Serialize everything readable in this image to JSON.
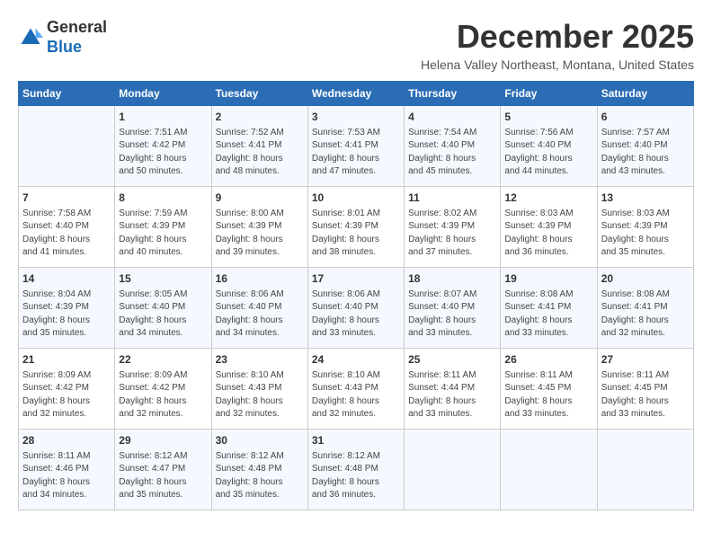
{
  "header": {
    "logo_line1": "General",
    "logo_line2": "Blue",
    "month": "December 2025",
    "location": "Helena Valley Northeast, Montana, United States"
  },
  "days_of_week": [
    "Sunday",
    "Monday",
    "Tuesday",
    "Wednesday",
    "Thursday",
    "Friday",
    "Saturday"
  ],
  "weeks": [
    [
      {
        "day": "",
        "info": ""
      },
      {
        "day": "1",
        "info": "Sunrise: 7:51 AM\nSunset: 4:42 PM\nDaylight: 8 hours\nand 50 minutes."
      },
      {
        "day": "2",
        "info": "Sunrise: 7:52 AM\nSunset: 4:41 PM\nDaylight: 8 hours\nand 48 minutes."
      },
      {
        "day": "3",
        "info": "Sunrise: 7:53 AM\nSunset: 4:41 PM\nDaylight: 8 hours\nand 47 minutes."
      },
      {
        "day": "4",
        "info": "Sunrise: 7:54 AM\nSunset: 4:40 PM\nDaylight: 8 hours\nand 45 minutes."
      },
      {
        "day": "5",
        "info": "Sunrise: 7:56 AM\nSunset: 4:40 PM\nDaylight: 8 hours\nand 44 minutes."
      },
      {
        "day": "6",
        "info": "Sunrise: 7:57 AM\nSunset: 4:40 PM\nDaylight: 8 hours\nand 43 minutes."
      }
    ],
    [
      {
        "day": "7",
        "info": "Sunrise: 7:58 AM\nSunset: 4:40 PM\nDaylight: 8 hours\nand 41 minutes."
      },
      {
        "day": "8",
        "info": "Sunrise: 7:59 AM\nSunset: 4:39 PM\nDaylight: 8 hours\nand 40 minutes."
      },
      {
        "day": "9",
        "info": "Sunrise: 8:00 AM\nSunset: 4:39 PM\nDaylight: 8 hours\nand 39 minutes."
      },
      {
        "day": "10",
        "info": "Sunrise: 8:01 AM\nSunset: 4:39 PM\nDaylight: 8 hours\nand 38 minutes."
      },
      {
        "day": "11",
        "info": "Sunrise: 8:02 AM\nSunset: 4:39 PM\nDaylight: 8 hours\nand 37 minutes."
      },
      {
        "day": "12",
        "info": "Sunrise: 8:03 AM\nSunset: 4:39 PM\nDaylight: 8 hours\nand 36 minutes."
      },
      {
        "day": "13",
        "info": "Sunrise: 8:03 AM\nSunset: 4:39 PM\nDaylight: 8 hours\nand 35 minutes."
      }
    ],
    [
      {
        "day": "14",
        "info": "Sunrise: 8:04 AM\nSunset: 4:39 PM\nDaylight: 8 hours\nand 35 minutes."
      },
      {
        "day": "15",
        "info": "Sunrise: 8:05 AM\nSunset: 4:40 PM\nDaylight: 8 hours\nand 34 minutes."
      },
      {
        "day": "16",
        "info": "Sunrise: 8:06 AM\nSunset: 4:40 PM\nDaylight: 8 hours\nand 34 minutes."
      },
      {
        "day": "17",
        "info": "Sunrise: 8:06 AM\nSunset: 4:40 PM\nDaylight: 8 hours\nand 33 minutes."
      },
      {
        "day": "18",
        "info": "Sunrise: 8:07 AM\nSunset: 4:40 PM\nDaylight: 8 hours\nand 33 minutes."
      },
      {
        "day": "19",
        "info": "Sunrise: 8:08 AM\nSunset: 4:41 PM\nDaylight: 8 hours\nand 33 minutes."
      },
      {
        "day": "20",
        "info": "Sunrise: 8:08 AM\nSunset: 4:41 PM\nDaylight: 8 hours\nand 32 minutes."
      }
    ],
    [
      {
        "day": "21",
        "info": "Sunrise: 8:09 AM\nSunset: 4:42 PM\nDaylight: 8 hours\nand 32 minutes."
      },
      {
        "day": "22",
        "info": "Sunrise: 8:09 AM\nSunset: 4:42 PM\nDaylight: 8 hours\nand 32 minutes."
      },
      {
        "day": "23",
        "info": "Sunrise: 8:10 AM\nSunset: 4:43 PM\nDaylight: 8 hours\nand 32 minutes."
      },
      {
        "day": "24",
        "info": "Sunrise: 8:10 AM\nSunset: 4:43 PM\nDaylight: 8 hours\nand 32 minutes."
      },
      {
        "day": "25",
        "info": "Sunrise: 8:11 AM\nSunset: 4:44 PM\nDaylight: 8 hours\nand 33 minutes."
      },
      {
        "day": "26",
        "info": "Sunrise: 8:11 AM\nSunset: 4:45 PM\nDaylight: 8 hours\nand 33 minutes."
      },
      {
        "day": "27",
        "info": "Sunrise: 8:11 AM\nSunset: 4:45 PM\nDaylight: 8 hours\nand 33 minutes."
      }
    ],
    [
      {
        "day": "28",
        "info": "Sunrise: 8:11 AM\nSunset: 4:46 PM\nDaylight: 8 hours\nand 34 minutes."
      },
      {
        "day": "29",
        "info": "Sunrise: 8:12 AM\nSunset: 4:47 PM\nDaylight: 8 hours\nand 35 minutes."
      },
      {
        "day": "30",
        "info": "Sunrise: 8:12 AM\nSunset: 4:48 PM\nDaylight: 8 hours\nand 35 minutes."
      },
      {
        "day": "31",
        "info": "Sunrise: 8:12 AM\nSunset: 4:48 PM\nDaylight: 8 hours\nand 36 minutes."
      },
      {
        "day": "",
        "info": ""
      },
      {
        "day": "",
        "info": ""
      },
      {
        "day": "",
        "info": ""
      }
    ]
  ]
}
